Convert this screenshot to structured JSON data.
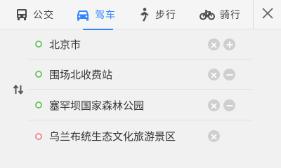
{
  "tabs": [
    {
      "label": "公交",
      "icon": "bus-icon",
      "active": false
    },
    {
      "label": "驾车",
      "icon": "car-icon",
      "active": true
    },
    {
      "label": "步行",
      "icon": "walk-icon",
      "active": false
    },
    {
      "label": "骑行",
      "icon": "bike-icon",
      "active": false
    }
  ],
  "waypoints": [
    {
      "name": "北京市",
      "type": "start",
      "action": "add"
    },
    {
      "name": "围场北收费站",
      "type": "via",
      "action": "remove"
    },
    {
      "name": "塞罕坝国家森林公园",
      "type": "via",
      "action": "remove"
    },
    {
      "name": "乌兰布统生态文化旅游景区",
      "type": "end",
      "action": "none"
    }
  ],
  "colors": {
    "accent": "#3385ff",
    "start_dot": "#72c267",
    "end_dot": "#f08a8a",
    "control_gray": "#cfcfcf"
  }
}
